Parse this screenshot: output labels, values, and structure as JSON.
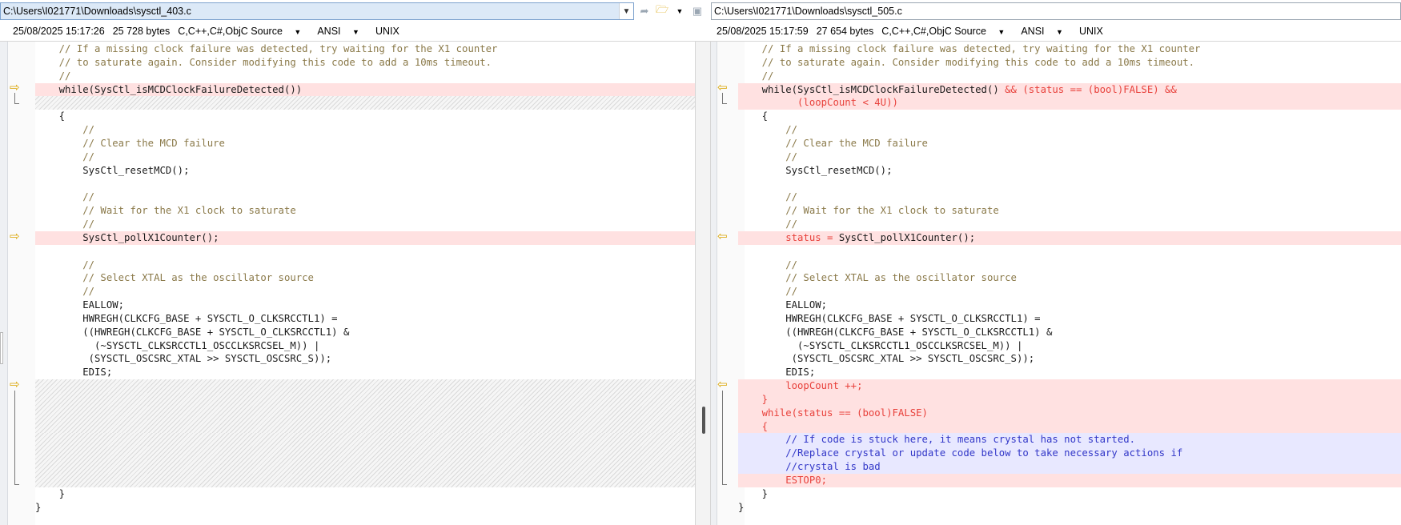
{
  "left": {
    "path": "C:\\Users\\I021771\\Downloads\\sysctl_403.c",
    "date": "25/08/2025 15:17:26",
    "size": "25 728 bytes",
    "language": "C,C++,C#,ObjC Source",
    "encoding": "ANSI",
    "line_endings": "UNIX",
    "lines": [
      {
        "t": "comment",
        "text": "    // If a missing clock failure was detected, try waiting for the X1 counter"
      },
      {
        "t": "comment",
        "text": "    // to saturate again. Consider modifying this code to add a 10ms timeout."
      },
      {
        "t": "comment",
        "text": "    //"
      },
      {
        "t": "changed",
        "text": "    while(SysCtl_isMCDClockFailureDetected())"
      },
      {
        "t": "filler",
        "text": ""
      },
      {
        "t": "plain",
        "text": "    {"
      },
      {
        "t": "comment",
        "text": "        //"
      },
      {
        "t": "comment",
        "text": "        // Clear the MCD failure"
      },
      {
        "t": "comment",
        "text": "        //"
      },
      {
        "t": "plain",
        "text": "        SysCtl_resetMCD();"
      },
      {
        "t": "plain",
        "text": ""
      },
      {
        "t": "comment",
        "text": "        //"
      },
      {
        "t": "comment",
        "text": "        // Wait for the X1 clock to saturate"
      },
      {
        "t": "comment",
        "text": "        //"
      },
      {
        "t": "changed",
        "text": "        SysCtl_pollX1Counter();"
      },
      {
        "t": "plain",
        "text": ""
      },
      {
        "t": "comment",
        "text": "        //"
      },
      {
        "t": "comment",
        "text": "        // Select XTAL as the oscillator source"
      },
      {
        "t": "comment",
        "text": "        //"
      },
      {
        "t": "plain",
        "text": "        EALLOW;"
      },
      {
        "t": "plain",
        "text": "        HWREGH(CLKCFG_BASE + SYSCTL_O_CLKSRCCTL1) ="
      },
      {
        "t": "plain",
        "text": "        ((HWREGH(CLKCFG_BASE + SYSCTL_O_CLKSRCCTL1) &"
      },
      {
        "t": "plain",
        "text": "          (~SYSCTL_CLKSRCCTL1_OSCCLKSRCSEL_M)) |"
      },
      {
        "t": "plain",
        "text": "         (SYSCTL_OSCSRC_XTAL >> SYSCTL_OSCSRC_S));"
      },
      {
        "t": "plain",
        "text": "        EDIS;"
      },
      {
        "t": "filler",
        "text": ""
      },
      {
        "t": "filler",
        "text": ""
      },
      {
        "t": "filler",
        "text": ""
      },
      {
        "t": "filler",
        "text": ""
      },
      {
        "t": "filler",
        "text": ""
      },
      {
        "t": "filler",
        "text": ""
      },
      {
        "t": "filler",
        "text": ""
      },
      {
        "t": "filler",
        "text": ""
      },
      {
        "t": "plain",
        "text": "    }"
      },
      {
        "t": "plain",
        "text": "}"
      }
    ]
  },
  "right": {
    "path": "C:\\Users\\I021771\\Downloads\\sysctl_505.c",
    "date": "25/08/2025 15:17:59",
    "size": "27 654 bytes",
    "language": "C,C++,C#,ObjC Source",
    "encoding": "ANSI",
    "line_endings": "UNIX",
    "lines": [
      {
        "t": "comment",
        "text": "    // If a missing clock failure was detected, try waiting for the X1 counter"
      },
      {
        "t": "comment",
        "text": "    // to saturate again. Consider modifying this code to add a 10ms timeout."
      },
      {
        "t": "comment",
        "text": "    //"
      },
      {
        "t": "changed",
        "parts": [
          [
            "plain",
            "    while(SysCtl_isMCDClockFailureDetected() "
          ],
          [
            "diff",
            "&& (status == (bool)FALSE) &&"
          ]
        ]
      },
      {
        "t": "changed",
        "parts": [
          [
            "diff",
            "          (loopCount < 4U))"
          ]
        ]
      },
      {
        "t": "plain",
        "text": "    {"
      },
      {
        "t": "comment",
        "text": "        //"
      },
      {
        "t": "comment",
        "text": "        // Clear the MCD failure"
      },
      {
        "t": "comment",
        "text": "        //"
      },
      {
        "t": "plain",
        "text": "        SysCtl_resetMCD();"
      },
      {
        "t": "plain",
        "text": ""
      },
      {
        "t": "comment",
        "text": "        //"
      },
      {
        "t": "comment",
        "text": "        // Wait for the X1 clock to saturate"
      },
      {
        "t": "comment",
        "text": "        //"
      },
      {
        "t": "changed",
        "parts": [
          [
            "diff",
            "        status = "
          ],
          [
            "plain",
            "SysCtl_pollX1Counter();"
          ]
        ]
      },
      {
        "t": "plain",
        "text": ""
      },
      {
        "t": "comment",
        "text": "        //"
      },
      {
        "t": "comment",
        "text": "        // Select XTAL as the oscillator source"
      },
      {
        "t": "comment",
        "text": "        //"
      },
      {
        "t": "plain",
        "text": "        EALLOW;"
      },
      {
        "t": "plain",
        "text": "        HWREGH(CLKCFG_BASE + SYSCTL_O_CLKSRCCTL1) ="
      },
      {
        "t": "plain",
        "text": "        ((HWREGH(CLKCFG_BASE + SYSCTL_O_CLKSRCCTL1) &"
      },
      {
        "t": "plain",
        "text": "          (~SYSCTL_CLKSRCCTL1_OSCCLKSRCSEL_M)) |"
      },
      {
        "t": "plain",
        "text": "         (SYSCTL_OSCSRC_XTAL >> SYSCTL_OSCSRC_S));"
      },
      {
        "t": "plain",
        "text": "        EDIS;"
      },
      {
        "t": "changed",
        "parts": [
          [
            "diff",
            "        loopCount ++;"
          ]
        ]
      },
      {
        "t": "changed",
        "parts": [
          [
            "diff",
            "    }"
          ]
        ]
      },
      {
        "t": "changed",
        "parts": [
          [
            "diff",
            "    while(status == (bool)FALSE)"
          ]
        ]
      },
      {
        "t": "changed",
        "parts": [
          [
            "diff",
            "    {"
          ]
        ]
      },
      {
        "t": "blue",
        "text": "        // If code is stuck here, it means crystal has not started."
      },
      {
        "t": "blue",
        "text": "        //Replace crystal or update code below to take necessary actions if"
      },
      {
        "t": "blue",
        "text": "        //crystal is bad"
      },
      {
        "t": "changed",
        "parts": [
          [
            "diff",
            "        ESTOP0;"
          ]
        ]
      },
      {
        "t": "plain",
        "text": "    }"
      },
      {
        "t": "plain",
        "text": "}"
      }
    ]
  },
  "icons": {
    "path_dropdown": "chevron-down-icon",
    "copy": "copy-to-other-side-icon",
    "open": "folder-open-icon",
    "save": "save-icon",
    "diff_marker_left": "arrow-right-icon",
    "diff_marker_right": "arrow-left-icon"
  },
  "colors": {
    "changed_bg": "#ffe1e1",
    "blue_bg": "#e8e8ff",
    "diff_text": "#e8413b",
    "comment_text": "#8b7a4a",
    "marker": "#d9a400"
  }
}
